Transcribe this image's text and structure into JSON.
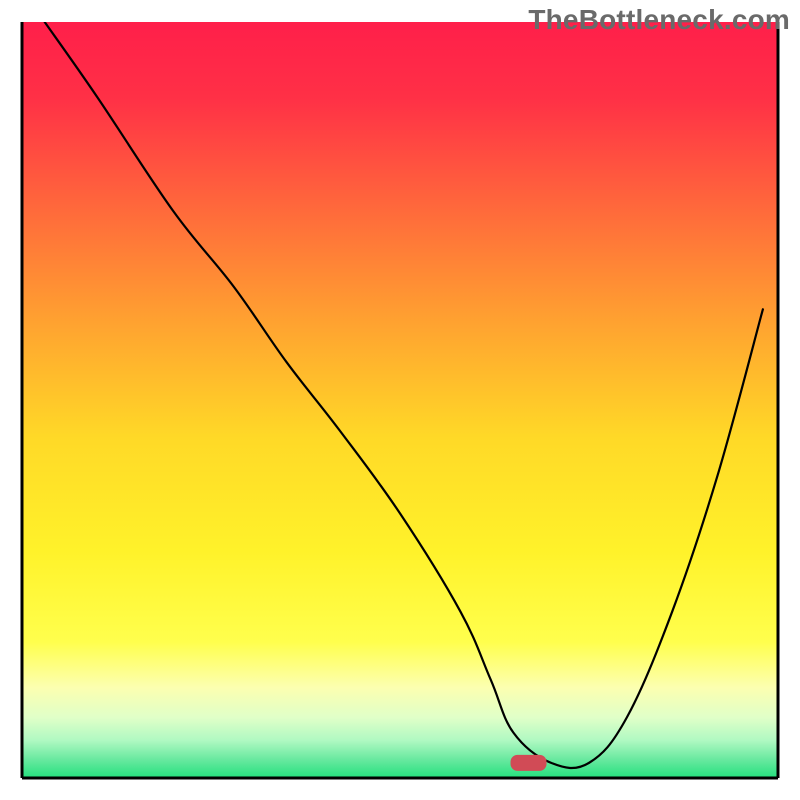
{
  "watermark": "TheBottleneck.com",
  "chart_data": {
    "type": "line",
    "title": "",
    "xlabel": "",
    "ylabel": "",
    "xlim": [
      0,
      100
    ],
    "ylim": [
      0,
      100
    ],
    "legend": false,
    "grid": false,
    "annotations": [
      {
        "type": "marker",
        "shape": "rounded-rect",
        "x": 67,
        "y": 2,
        "color": "#d14b56"
      }
    ],
    "background_gradient": {
      "stops": [
        {
          "offset": 0.0,
          "color": "#ff1f4a"
        },
        {
          "offset": 0.1,
          "color": "#ff3046"
        },
        {
          "offset": 0.25,
          "color": "#ff6a3b"
        },
        {
          "offset": 0.4,
          "color": "#ffa330"
        },
        {
          "offset": 0.55,
          "color": "#ffd927"
        },
        {
          "offset": 0.7,
          "color": "#fff22a"
        },
        {
          "offset": 0.82,
          "color": "#ffff4d"
        },
        {
          "offset": 0.88,
          "color": "#fcffb0"
        },
        {
          "offset": 0.92,
          "color": "#e0ffc8"
        },
        {
          "offset": 0.95,
          "color": "#b0f9c2"
        },
        {
          "offset": 0.975,
          "color": "#6ae9a0"
        },
        {
          "offset": 1.0,
          "color": "#24e07e"
        }
      ]
    },
    "series": [
      {
        "name": "bottleneck-curve",
        "color": "#000000",
        "x": [
          3,
          10,
          20,
          28,
          35,
          42,
          50,
          58,
          62,
          65,
          70,
          75,
          80,
          86,
          92,
          98
        ],
        "y": [
          100,
          90,
          75,
          65,
          55,
          46,
          35,
          22,
          13,
          6,
          2,
          2,
          8,
          22,
          40,
          62
        ]
      }
    ]
  }
}
